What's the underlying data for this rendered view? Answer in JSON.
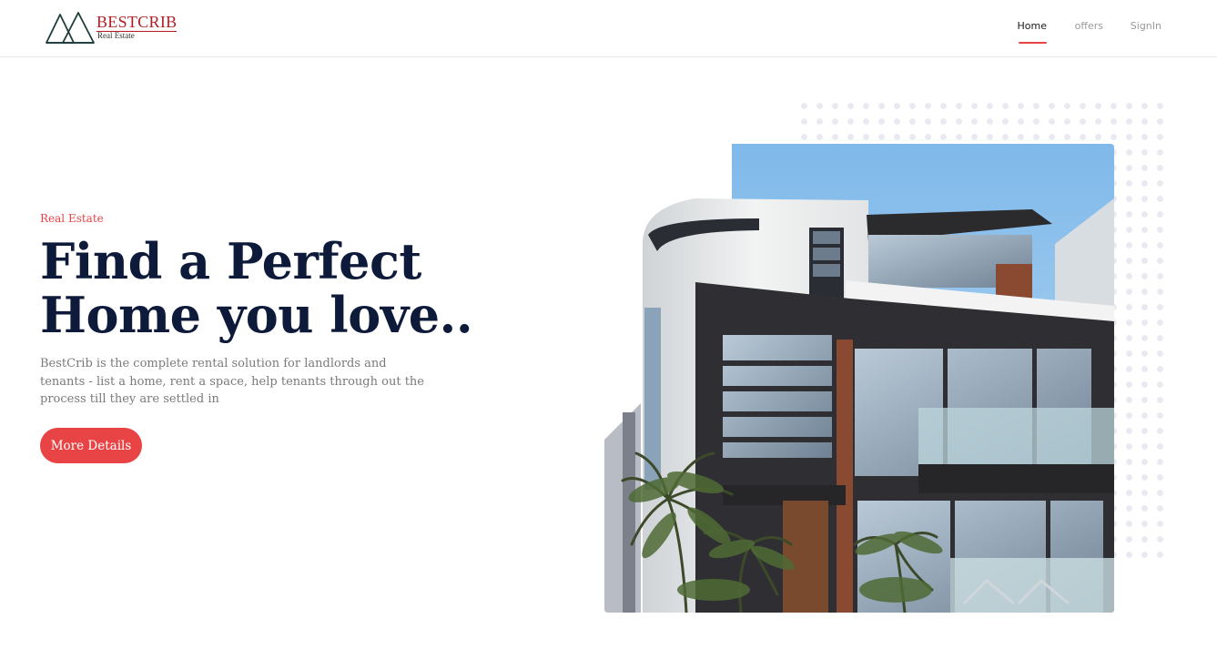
{
  "brand": {
    "name": "BESTCRIB",
    "tagline": "Real Estate"
  },
  "nav": {
    "items": [
      {
        "label": "Home",
        "active": true
      },
      {
        "label": "offers",
        "active": false
      },
      {
        "label": "SignIn",
        "active": false
      }
    ]
  },
  "hero": {
    "eyebrow": "Real Estate",
    "headline_line1": "Find a Perfect",
    "headline_line2": "Home you love..",
    "description": "BestCrib is the complete rental solution for landlords and tenants - list a home, rent a space, help tenants through out the process till they are settled in",
    "cta_label": "More Details"
  },
  "colors": {
    "accent": "#e84445",
    "heading": "#0d1a3a",
    "brand": "#b01f24",
    "body_text": "#7a7a7a"
  },
  "icons": {
    "logo": "mountain-peaks-icon"
  }
}
